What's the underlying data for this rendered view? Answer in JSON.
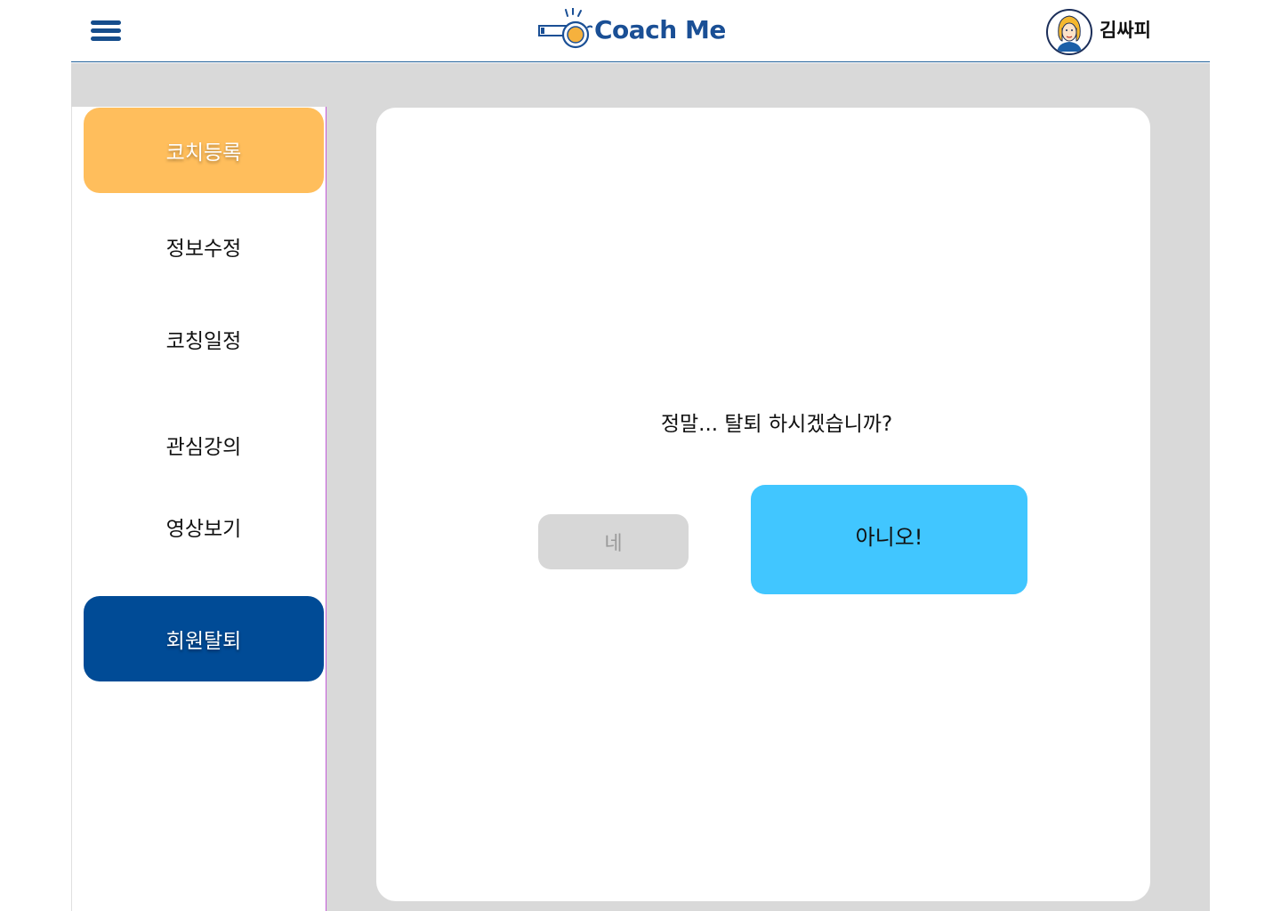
{
  "header": {
    "logo_text": "Coach Me",
    "logo_icon": "whistle-icon",
    "menu_icon": "hamburger-menu-icon",
    "user": {
      "name": "김싸피",
      "avatar_icon": "user-avatar-icon"
    }
  },
  "sidebar": {
    "items": [
      {
        "label": "코치등록",
        "style": "primary"
      },
      {
        "label": "정보수정",
        "style": "plain"
      },
      {
        "label": "코칭일정",
        "style": "plain"
      },
      {
        "label": "관심강의",
        "style": "plain"
      },
      {
        "label": "영상보기",
        "style": "plain"
      },
      {
        "label": "회원탈퇴",
        "style": "active"
      }
    ]
  },
  "dialog": {
    "question": "정말... 탈퇴 하시겠습니까?",
    "yes_label": "네",
    "no_label": "아니오!"
  },
  "colors": {
    "brand_blue": "#1a4f95",
    "active_nav": "#004b96",
    "primary_nav": "#ffbe5c",
    "no_button": "#41c6ff",
    "yes_button": "#d7d7d7",
    "background": "#d9d9d9"
  }
}
